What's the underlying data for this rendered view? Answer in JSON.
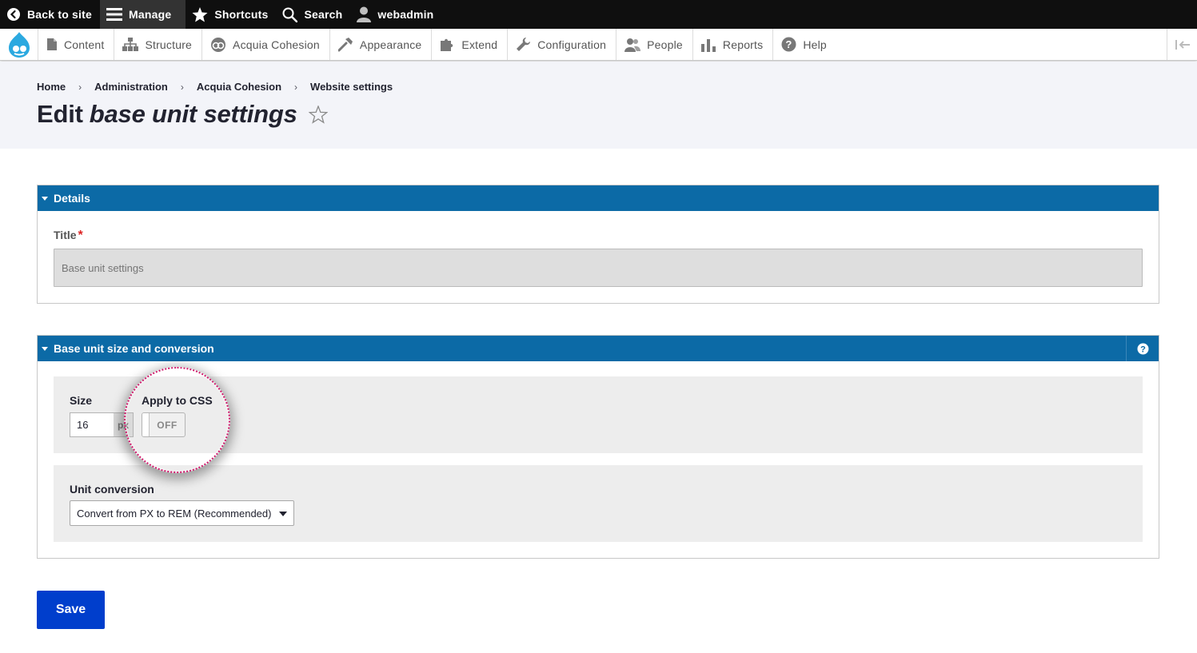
{
  "toolbar": {
    "back": {
      "label": "Back to site",
      "icon": "back-arrow-icon"
    },
    "manage": {
      "label": "Manage",
      "icon": "hamburger-menu-icon"
    },
    "shortcuts": {
      "label": "Shortcuts",
      "icon": "star-icon"
    },
    "search": {
      "label": "Search",
      "icon": "search-icon"
    },
    "user": {
      "label": "webadmin",
      "icon": "user-icon"
    }
  },
  "tray": {
    "logo": "drupal-logo-icon",
    "items": [
      {
        "label": "Content",
        "icon": "document-icon"
      },
      {
        "label": "Structure",
        "icon": "sitemap-icon"
      },
      {
        "label": "Acquia Cohesion",
        "icon": "cohesion-icon"
      },
      {
        "label": "Appearance",
        "icon": "paintbrush-icon"
      },
      {
        "label": "Extend",
        "icon": "puzzle-icon"
      },
      {
        "label": "Configuration",
        "icon": "wrench-icon"
      },
      {
        "label": "People",
        "icon": "people-icon"
      },
      {
        "label": "Reports",
        "icon": "bar-chart-icon"
      },
      {
        "label": "Help",
        "icon": "help-icon"
      }
    ],
    "toggle_icon": "collapse-toolbar-icon"
  },
  "breadcrumb": [
    "Home",
    "Administration",
    "Acquia Cohesion",
    "Website settings"
  ],
  "page": {
    "title_prefix": "Edit",
    "title_entity": "base unit settings",
    "shortcut_icon": "star-outline-icon"
  },
  "details": {
    "legend": "Details",
    "title_label": "Title",
    "required_mark": "*",
    "title_placeholder": "Base unit settings"
  },
  "base_unit": {
    "legend": "Base unit size and conversion",
    "help_icon": "question-icon",
    "size_label": "Size",
    "size_value": "16",
    "size_suffix": "px",
    "apply_label": "Apply to CSS",
    "apply_state": "OFF",
    "conversion_label": "Unit conversion",
    "conversion_selected": "Convert from PX to REM (Recommended)"
  },
  "actions": {
    "save_label": "Save"
  },
  "colors": {
    "primary_blue": "#0c6aa6",
    "save_blue": "#003ecc",
    "highlight": "#d0186b"
  }
}
